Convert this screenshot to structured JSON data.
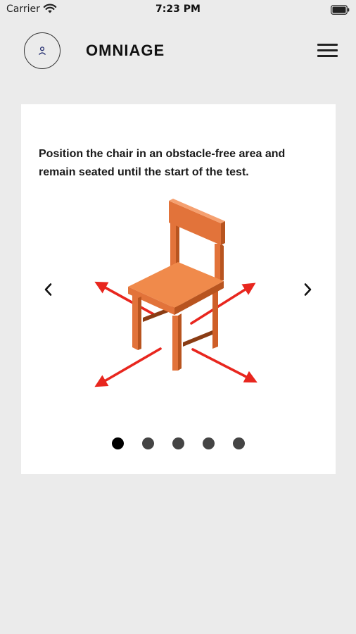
{
  "status_bar": {
    "carrier": "Carrier",
    "time": "7:23 PM",
    "icons": [
      "wifi-icon",
      "battery-icon"
    ]
  },
  "header": {
    "brand": "OMNIAGE",
    "avatar_icon": "user-icon",
    "menu_icon": "hamburger-menu-icon"
  },
  "onboarding": {
    "instruction": "Position the chair in an obstacle-free area and remain seated until the start of the test.",
    "illustration_icon": "chair-with-clearance-arrows-illustration",
    "prev_icon": "chevron-left-icon",
    "next_icon": "chevron-right-icon",
    "slides_total": 5,
    "active_slide": 1
  },
  "colors": {
    "background": "#ebebeb",
    "card": "#ffffff",
    "chair_top": "#f08a4b",
    "chair_front": "#e2733a",
    "chair_shadow": "#b8541f",
    "arrow": "#e8261e",
    "dot_active": "#000000",
    "dot_inactive": "#444444"
  }
}
